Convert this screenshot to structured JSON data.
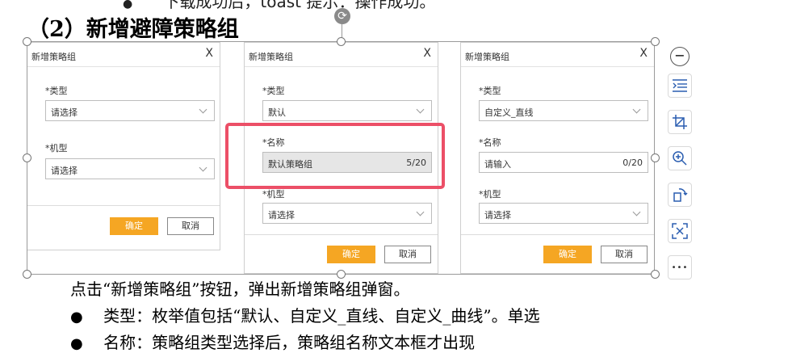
{
  "doc": {
    "top_line": "下载成功后，toast 提示：操作成功。",
    "heading": "（2）新增避障策略组",
    "paragraph": "点击“新增策略组”按钮，弹出新增策略组弹窗。",
    "bullets": [
      "类型：枚举值包括“默认、自定义_直线、自定义_曲线”。单选",
      "名称：策略组类型选择后，策略组名称文本框才出现"
    ]
  },
  "dialogs": [
    {
      "title": "新增策略组",
      "close": "X",
      "type_label": "*类型",
      "type_value": "请选择",
      "model_label": "*机型",
      "model_value": "请选择",
      "ok": "确定",
      "cancel": "取消"
    },
    {
      "title": "新增策略组",
      "close": "X",
      "type_label": "*类型",
      "type_value": "默认",
      "name_label": "*名称",
      "name_value": "默认策略组",
      "name_count": "5/20",
      "model_label": "*机型",
      "model_value": "请选择",
      "ok": "确定",
      "cancel": "取消"
    },
    {
      "title": "新增策略组",
      "close": "X",
      "type_label": "*类型",
      "type_value": "自定义_直线",
      "name_label": "*名称",
      "name_placeholder": "请输入",
      "name_count": "0/20",
      "model_label": "*机型",
      "model_value": "请选择",
      "ok": "确定",
      "cancel": "取消"
    }
  ],
  "toolbar": {
    "icons": [
      "collapse-icon",
      "wrap-text-icon",
      "crop-icon",
      "zoom-in-icon",
      "rotate-icon",
      "extract-text-icon",
      "more-icon"
    ],
    "more": "•••"
  },
  "colors": {
    "accent": "#f5a623",
    "highlight": "#ec4f67"
  }
}
